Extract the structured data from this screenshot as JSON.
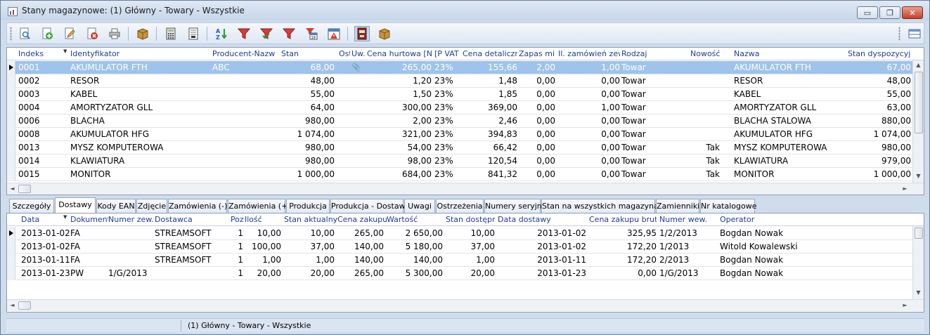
{
  "window": {
    "title": "Stany magazynowe: (1) Główny - Towary - Wszystkie",
    "controls": {
      "minimize": "▭",
      "restore": "❐",
      "close": "✕"
    }
  },
  "toolbar": {
    "buttons": [
      {
        "name": "preview-icon"
      },
      {
        "name": "add-icon"
      },
      {
        "name": "edit-icon"
      },
      {
        "name": "delete-icon"
      },
      {
        "name": "print-icon"
      },
      {
        "name": "box-icon"
      },
      {
        "name": "calculator-icon"
      },
      {
        "name": "document-icon"
      },
      {
        "name": "sort-az-icon"
      },
      {
        "name": "filter-icon"
      },
      {
        "name": "filter-list-icon"
      },
      {
        "name": "filter-clear-icon"
      },
      {
        "name": "calendar-filter-icon"
      },
      {
        "name": "calendar-warning-icon"
      },
      {
        "name": "book-icon"
      },
      {
        "name": "package-icon"
      },
      {
        "name": "layout-icon"
      }
    ]
  },
  "items_grid": {
    "columns": [
      "Indeks",
      "Identyfikator",
      "Producent-Nazwa",
      "Stan",
      "Ost",
      "Uw.",
      "Cena hurtowa [N]",
      "[P VAT",
      "Cena detaliczna",
      "Zapas min.",
      "Il. zamówień zew.",
      "Rodzaj",
      "Nowość",
      "Nazwa",
      "Stan dyspozycyjny"
    ],
    "rows": [
      {
        "indeks": "0001",
        "identyfikator": "AKUMULATOR FTH",
        "producent": "ABC",
        "stan": "68,00",
        "uw": "📎",
        "cena_hurtowa": "265,00",
        "vat": "23%",
        "cena_detaliczna": "155,66",
        "zapas": "2,00",
        "zamowien": "1,00",
        "rodzaj": "Towar",
        "nowosc": "",
        "nazwa": "AKUMULATOR FTH",
        "dyspozycyjny": "67,00"
      },
      {
        "indeks": "0002",
        "identyfikator": "RESOR",
        "producent": "",
        "stan": "48,00",
        "uw": "",
        "cena_hurtowa": "1,20",
        "vat": "23%",
        "cena_detaliczna": "1,48",
        "zapas": "0,00",
        "zamowien": "0,00",
        "rodzaj": "Towar",
        "nowosc": "",
        "nazwa": "RESOR",
        "dyspozycyjny": "48,00"
      },
      {
        "indeks": "0003",
        "identyfikator": "KABEL",
        "producent": "",
        "stan": "55,00",
        "uw": "",
        "cena_hurtowa": "1,50",
        "vat": "23%",
        "cena_detaliczna": "1,85",
        "zapas": "0,00",
        "zamowien": "0,00",
        "rodzaj": "Towar",
        "nowosc": "",
        "nazwa": "KABEL",
        "dyspozycyjny": "55,00"
      },
      {
        "indeks": "0004",
        "identyfikator": "AMORTYZATOR GLL",
        "producent": "",
        "stan": "64,00",
        "uw": "",
        "cena_hurtowa": "300,00",
        "vat": "23%",
        "cena_detaliczna": "369,00",
        "zapas": "0,00",
        "zamowien": "1,00",
        "rodzaj": "Towar",
        "nowosc": "",
        "nazwa": "AMORTYZATOR GLL",
        "dyspozycyjny": "63,00"
      },
      {
        "indeks": "0006",
        "identyfikator": "BLACHA",
        "producent": "",
        "stan": "980,00",
        "uw": "",
        "cena_hurtowa": "2,00",
        "vat": "23%",
        "cena_detaliczna": "2,46",
        "zapas": "0,00",
        "zamowien": "0,00",
        "rodzaj": "Towar",
        "nowosc": "",
        "nazwa": "BLACHA STALOWA",
        "dyspozycyjny": "880,00"
      },
      {
        "indeks": "0008",
        "identyfikator": "AKUMULATOR HFG",
        "producent": "",
        "stan": "1 074,00",
        "uw": "",
        "cena_hurtowa": "321,00",
        "vat": "23%",
        "cena_detaliczna": "394,83",
        "zapas": "0,00",
        "zamowien": "0,00",
        "rodzaj": "Towar",
        "nowosc": "",
        "nazwa": "AKUMULATOR HFG",
        "dyspozycyjny": "1 074,00"
      },
      {
        "indeks": "0013",
        "identyfikator": "MYSZ KOMPUTEROWA",
        "producent": "",
        "stan": "980,00",
        "uw": "",
        "cena_hurtowa": "54,00",
        "vat": "23%",
        "cena_detaliczna": "66,42",
        "zapas": "0,00",
        "zamowien": "0,00",
        "rodzaj": "Towar",
        "nowosc": "Tak",
        "nazwa": "MYSZ KOMPUTEROWA",
        "dyspozycyjny": "980,00"
      },
      {
        "indeks": "0014",
        "identyfikator": "KLAWIATURA",
        "producent": "",
        "stan": "980,00",
        "uw": "",
        "cena_hurtowa": "98,00",
        "vat": "23%",
        "cena_detaliczna": "120,54",
        "zapas": "0,00",
        "zamowien": "0,00",
        "rodzaj": "Towar",
        "nowosc": "Tak",
        "nazwa": "KLAWIATURA",
        "dyspozycyjny": "979,00"
      },
      {
        "indeks": "0015",
        "identyfikator": "MONITOR",
        "producent": "",
        "stan": "1 000,00",
        "uw": "",
        "cena_hurtowa": "684,00",
        "vat": "23%",
        "cena_detaliczna": "841,32",
        "zapas": "0,00",
        "zamowien": "0,00",
        "rodzaj": "Towar",
        "nowosc": "Tak",
        "nazwa": "MONITOR",
        "dyspozycyjny": "1 000,00"
      }
    ]
  },
  "tabs": [
    "Szczegóły",
    "Dostawy",
    "Kody EAN",
    "Zdjęcie",
    "Zamówienia (-)",
    "Zamówienia (+)",
    "Produkcja",
    "Produkcja - Dostawy",
    "Uwagi",
    "Ostrzeżenia",
    "Numery seryjne",
    "Stan na wszystkich magazynach",
    "Zamienniki",
    "Nr katalogowe"
  ],
  "active_tab": "Dostawy",
  "deliveries_grid": {
    "columns": [
      "Data",
      "Dokument",
      "Numer zew.",
      "Dostawca",
      "Poz",
      "Ilość",
      "Stan aktualny",
      "Cena zakupu",
      "Wartość",
      "Stan dostępny",
      "Data dostawy",
      "Cena zakupu brutto",
      "Numer wew.",
      "Operator"
    ],
    "rows": [
      {
        "data": "2013-01-02",
        "dokument": "FA",
        "numer_zew": "",
        "dostawca": "STREAMSOFT",
        "poz": "1",
        "ilosc": "10,00",
        "stan_aktualny": "10,00",
        "cena_zakupu": "265,00",
        "wartosc": "2 650,00",
        "stan_dostepny": "10,00",
        "data_dostawy": "2013-01-02",
        "cena_brutto": "325,95",
        "numer_wew": "1/2/2013",
        "operator": "Bogdan Nowak"
      },
      {
        "data": "2013-01-02",
        "dokument": "FA",
        "numer_zew": "",
        "dostawca": "STREAMSOFT",
        "poz": "1",
        "ilosc": "100,00",
        "stan_aktualny": "37,00",
        "cena_zakupu": "140,00",
        "wartosc": "5 180,00",
        "stan_dostepny": "37,00",
        "data_dostawy": "2013-01-02",
        "cena_brutto": "172,20",
        "numer_wew": "1/2013",
        "operator": "Witold Kowalewski"
      },
      {
        "data": "2013-01-11",
        "dokument": "FA",
        "numer_zew": "",
        "dostawca": "STREAMSOFT",
        "poz": "1",
        "ilosc": "1,00",
        "stan_aktualny": "1,00",
        "cena_zakupu": "140,00",
        "wartosc": "140,00",
        "stan_dostepny": "1,00",
        "data_dostawy": "2013-01-11",
        "cena_brutto": "172,20",
        "numer_wew": "2/2013",
        "operator": "Bogdan Nowak"
      },
      {
        "data": "2013-01-23",
        "dokument": "PW",
        "numer_zew": "1/G/2013",
        "dostawca": "",
        "poz": "1",
        "ilosc": "20,00",
        "stan_aktualny": "20,00",
        "cena_zakupu": "265,00",
        "wartosc": "5 300,00",
        "stan_dostepny": "20,00",
        "data_dostawy": "2013-01-23",
        "cena_brutto": "0,00",
        "numer_wew": "1/G/2013",
        "operator": "Bogdan Nowak"
      }
    ]
  },
  "statusbar": {
    "text": "(1) Główny - Towary - Wszystkie"
  }
}
